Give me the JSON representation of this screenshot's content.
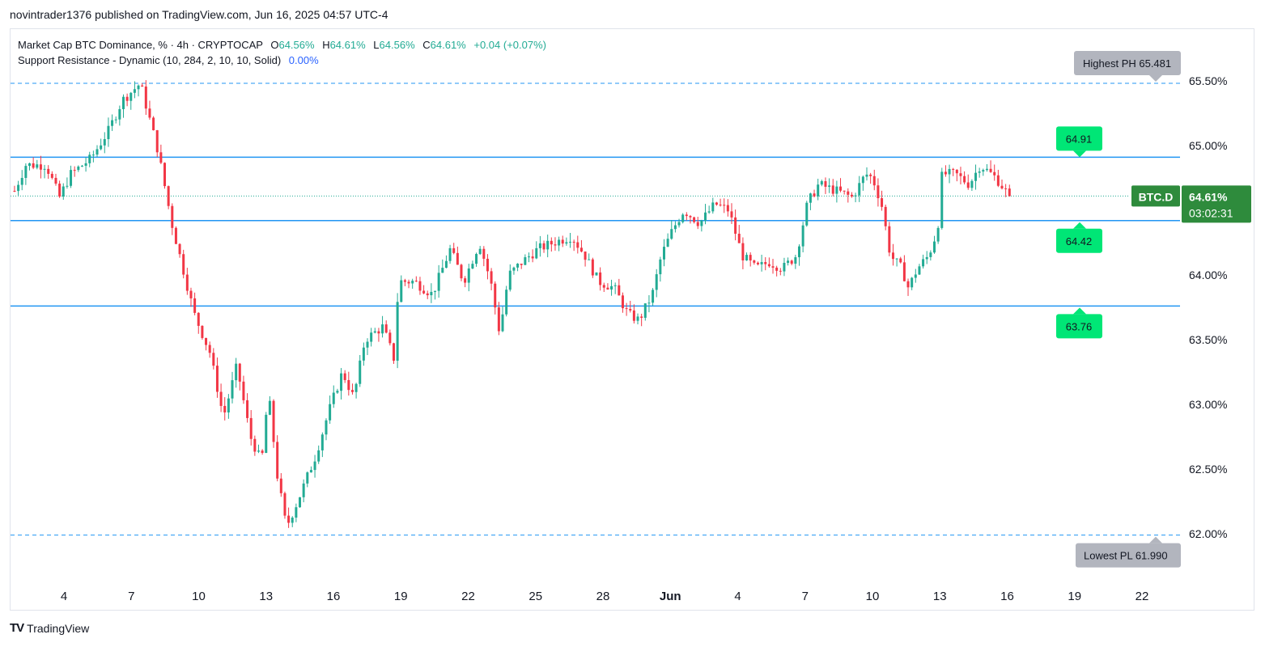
{
  "header": {
    "published_text": "novintrader1376 published on TradingView.com, Jun 16, 2025 04:57 UTC-4"
  },
  "legend": {
    "symbol": "Market Cap BTC Dominance, % · 4h · CRYPTOCAP",
    "o_label": "O",
    "o_value": "64.56%",
    "h_label": "H",
    "h_value": "64.61%",
    "l_label": "L",
    "l_value": "64.56%",
    "c_label": "C",
    "c_value": "64.61%",
    "change": "+0.04 (+0.07%)",
    "indicator": "Support Resistance - Dynamic (10, 284, 2, 10, 10, Solid)",
    "indicator_value": "0.00%"
  },
  "footer": {
    "brand": "TradingView",
    "logo_text": "TV"
  },
  "colors": {
    "up": "#22ab94",
    "down": "#f23645",
    "level": "#2196f3",
    "label_green": "#00e676",
    "price_tag": "#2e8b3c",
    "gray_label": "#b2b5be",
    "axis_text": "#131722"
  },
  "chart_data": {
    "type": "candlestick",
    "ylim": [
      61.75,
      65.75
    ],
    "y_ticks": [
      "65.50%",
      "65.00%",
      "64.00%",
      "63.50%",
      "63.00%",
      "62.50%",
      "62.00%"
    ],
    "y_tick_values": [
      65.5,
      65.0,
      64.0,
      63.5,
      63.0,
      62.5,
      62.0
    ],
    "x_ticks": [
      "4",
      "7",
      "10",
      "13",
      "16",
      "19",
      "22",
      "25",
      "28",
      "Jun",
      "4",
      "7",
      "10",
      "13",
      "16",
      "19",
      "22"
    ],
    "x_tick_days": [
      4,
      7,
      10,
      13,
      16,
      19,
      22,
      25,
      28,
      31,
      34,
      37,
      40,
      43,
      46,
      49,
      52
    ],
    "x_range_days": [
      1.8,
      53.1
    ],
    "support_resistance_levels": [
      {
        "value": 64.91,
        "label": "64.91"
      },
      {
        "value": 64.42,
        "label": "64.42"
      },
      {
        "value": 63.76,
        "label": "63.76"
      }
    ],
    "highest_ph": {
      "value": 65.481,
      "label": "Highest PH 65.481"
    },
    "lowest_pl": {
      "value": 61.99,
      "label": "Lowest PL 61.990"
    },
    "last_price": {
      "value": 64.61,
      "label": "64.61%",
      "countdown": "03:02:31",
      "symbol_tag": "BTC.D"
    },
    "anchor_points": [
      [
        1.8,
        64.65
      ],
      [
        2.3,
        64.85
      ],
      [
        3.2,
        64.85
      ],
      [
        3.8,
        64.6
      ],
      [
        4.3,
        64.78
      ],
      [
        5.2,
        64.9
      ],
      [
        6.0,
        65.12
      ],
      [
        6.6,
        65.35
      ],
      [
        7.4,
        65.48
      ],
      [
        8.2,
        64.95
      ],
      [
        8.8,
        64.4
      ],
      [
        9.3,
        64.05
      ],
      [
        9.8,
        63.7
      ],
      [
        10.5,
        63.4
      ],
      [
        11.1,
        62.9
      ],
      [
        11.7,
        63.3
      ],
      [
        12.3,
        62.75
      ],
      [
        12.8,
        62.55
      ],
      [
        13.1,
        63.1
      ],
      [
        13.5,
        62.45
      ],
      [
        13.9,
        62.05
      ],
      [
        14.4,
        62.25
      ],
      [
        15.2,
        62.6
      ],
      [
        15.8,
        62.95
      ],
      [
        16.4,
        63.25
      ],
      [
        16.9,
        63.05
      ],
      [
        17.4,
        63.5
      ],
      [
        18.2,
        63.6
      ],
      [
        18.7,
        63.35
      ],
      [
        18.9,
        63.95
      ],
      [
        19.6,
        63.95
      ],
      [
        20.4,
        63.85
      ],
      [
        21.2,
        64.2
      ],
      [
        21.8,
        63.95
      ],
      [
        22.5,
        64.25
      ],
      [
        23.0,
        63.95
      ],
      [
        23.4,
        63.55
      ],
      [
        23.8,
        64.0
      ],
      [
        24.4,
        64.1
      ],
      [
        25.1,
        64.2
      ],
      [
        25.8,
        64.25
      ],
      [
        26.6,
        64.3
      ],
      [
        27.2,
        64.15
      ],
      [
        27.8,
        63.95
      ],
      [
        28.5,
        63.9
      ],
      [
        29.1,
        63.7
      ],
      [
        29.6,
        63.65
      ],
      [
        30.2,
        63.85
      ],
      [
        30.6,
        64.15
      ],
      [
        31.1,
        64.35
      ],
      [
        31.6,
        64.5
      ],
      [
        32.3,
        64.4
      ],
      [
        33.0,
        64.55
      ],
      [
        33.6,
        64.5
      ],
      [
        34.2,
        64.15
      ],
      [
        34.8,
        64.05
      ],
      [
        35.4,
        64.1
      ],
      [
        36.0,
        64.05
      ],
      [
        36.6,
        64.15
      ],
      [
        37.1,
        64.55
      ],
      [
        37.6,
        64.7
      ],
      [
        38.4,
        64.65
      ],
      [
        39.1,
        64.6
      ],
      [
        39.7,
        64.78
      ],
      [
        40.0,
        64.75
      ],
      [
        40.4,
        64.55
      ],
      [
        40.8,
        64.15
      ],
      [
        41.3,
        64.05
      ],
      [
        41.6,
        63.9
      ],
      [
        42.0,
        64.05
      ],
      [
        42.5,
        64.15
      ],
      [
        42.9,
        64.35
      ],
      [
        43.1,
        64.78
      ],
      [
        43.7,
        64.78
      ],
      [
        44.3,
        64.7
      ],
      [
        44.8,
        64.85
      ],
      [
        45.5,
        64.75
      ],
      [
        46.1,
        64.61
      ]
    ],
    "candle_count": 266
  }
}
